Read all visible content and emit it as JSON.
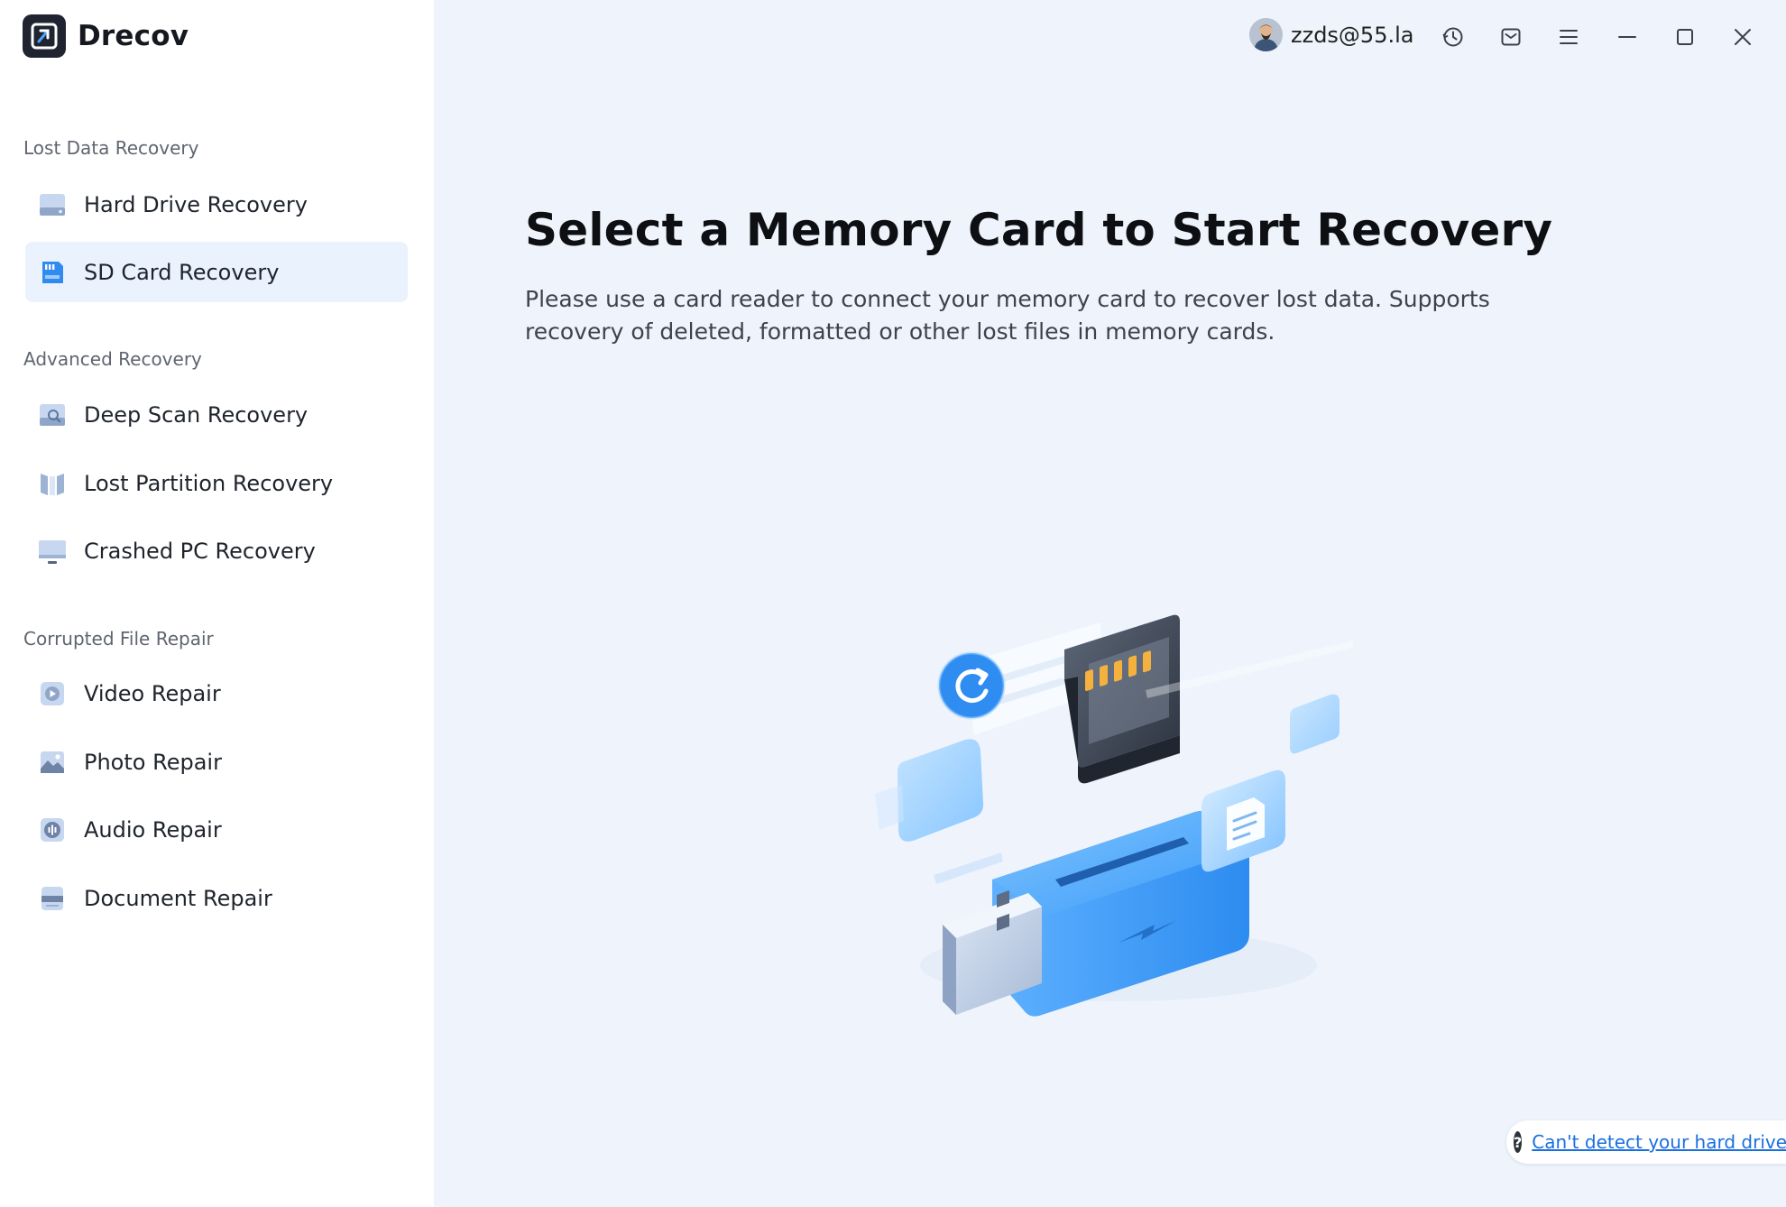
{
  "app": {
    "name": "Drecov"
  },
  "sidebar": {
    "sections": [
      {
        "title": "Lost Data Recovery",
        "items": [
          {
            "label": "Hard Drive Recovery",
            "icon": "hard-drive-icon",
            "active": false
          },
          {
            "label": "SD Card Recovery",
            "icon": "sd-card-icon",
            "active": true
          }
        ]
      },
      {
        "title": "Advanced Recovery",
        "items": [
          {
            "label": "Deep Scan Recovery",
            "icon": "deep-scan-icon",
            "active": false
          },
          {
            "label": "Lost Partition Recovery",
            "icon": "partition-icon",
            "active": false
          },
          {
            "label": "Crashed PC Recovery",
            "icon": "monitor-icon",
            "active": false
          }
        ]
      },
      {
        "title": "Corrupted File Repair",
        "items": [
          {
            "label": "Video Repair",
            "icon": "video-icon",
            "active": false
          },
          {
            "label": "Photo Repair",
            "icon": "photo-icon",
            "active": false
          },
          {
            "label": "Audio Repair",
            "icon": "audio-icon",
            "active": false
          },
          {
            "label": "Document Repair",
            "icon": "document-icon",
            "active": false
          }
        ]
      }
    ]
  },
  "topbar": {
    "user": "zzds@55.la",
    "buttons": [
      "history-icon",
      "mail-icon",
      "menu-icon",
      "minimize-icon",
      "maximize-icon",
      "close-icon"
    ]
  },
  "main": {
    "heading": "Select a Memory Card to Start Recovery",
    "description": "Please use a card reader to connect your memory card to recover lost data. Supports recovery of deleted, formatted or other lost files in memory cards.",
    "help_link": "Can't detect your hard drive?"
  },
  "colors": {
    "accent": "#1a6fe0",
    "sidebar_bg": "#ffffff",
    "main_bg": "#eff4fc",
    "active_item_bg": "#eaf2fd"
  }
}
